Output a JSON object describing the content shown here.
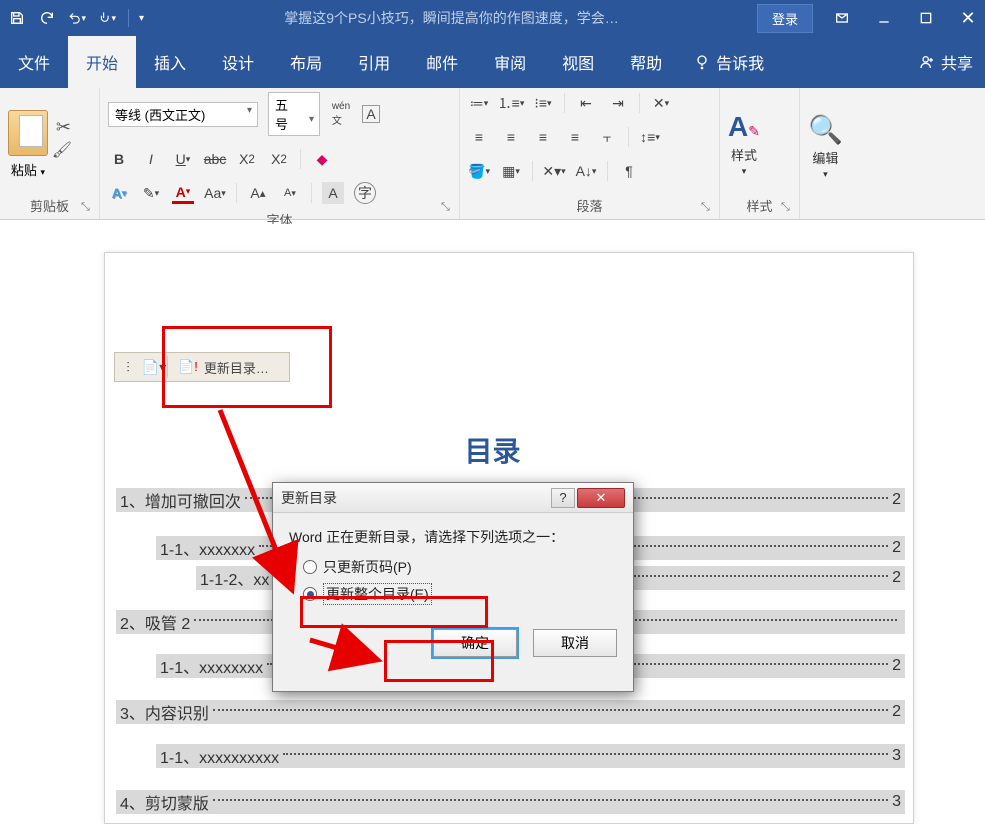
{
  "titlebar": {
    "doc_title": "掌握这9个PS小技巧，瞬间提高你的作图速度，学会…",
    "login": "登录"
  },
  "tabs": {
    "file": "文件",
    "home": "开始",
    "insert": "插入",
    "design": "设计",
    "layout": "布局",
    "references": "引用",
    "mailings": "邮件",
    "review": "审阅",
    "view": "视图",
    "help": "帮助",
    "tell_me": "告诉我",
    "share": "共享"
  },
  "ribbon": {
    "clipboard_label": "剪贴板",
    "paste_label": "粘贴",
    "font_name": "等线 (西文正文)",
    "font_size": "五号",
    "font_label": "字体",
    "para_label": "段落",
    "styles_label": "样式",
    "edit_label": "编辑"
  },
  "doc": {
    "update_toc": "更新目录…",
    "toc_title": "目录",
    "toc": [
      {
        "text": "1、增加可撤回次",
        "page": "2",
        "indent": 0
      },
      {
        "text": "1-1、xxxxxxx",
        "page": "2",
        "indent": 1
      },
      {
        "text": "1-1-2、xx",
        "page": "2",
        "indent": 2
      },
      {
        "text": "2、吸管 2",
        "page": "",
        "indent": 0
      },
      {
        "text": "1-1、xxxxxxxx",
        "page": "2",
        "indent": 1
      },
      {
        "text": "3、内容识别",
        "page": "2",
        "indent": 0
      },
      {
        "text": "1-1、xxxxxxxxxx",
        "page": "3",
        "indent": 1
      },
      {
        "text": "4、剪切蒙版",
        "page": "3",
        "indent": 0
      }
    ]
  },
  "dialog": {
    "title": "更新目录",
    "prompt": "Word 正在更新目录，请选择下列选项之一：",
    "opt_pages": "只更新页码(P)",
    "opt_all": "更新整个目录(E)",
    "ok": "确定",
    "cancel": "取消"
  }
}
